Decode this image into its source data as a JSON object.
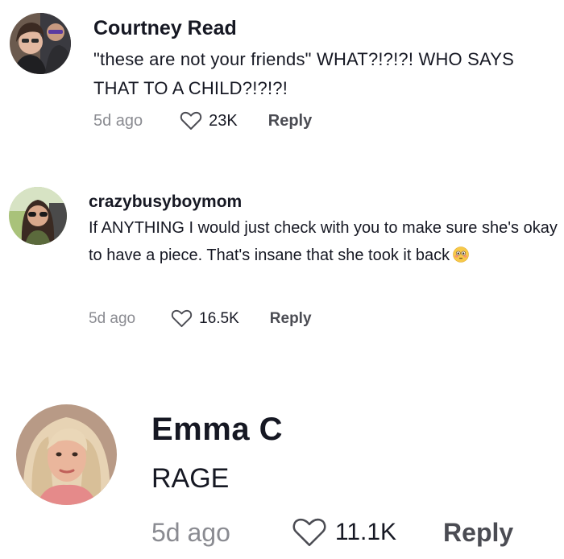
{
  "comments": [
    {
      "username": "Courtney Read",
      "text": "\"these are not your friends\" WHAT?!?!?! WHO SAYS THAT TO A CHILD?!?!?!",
      "time": "5d ago",
      "likes": "23K",
      "reply_label": "Reply",
      "avatar_icon": "user-avatar"
    },
    {
      "username": "crazybusyboymom",
      "text": "If ANYTHING I would just check with you to make sure she's okay to have a piece. That's insane that she took it back",
      "emoji": "flushed-face-emoji",
      "time": "5d ago",
      "likes": "16.5K",
      "reply_label": "Reply",
      "avatar_icon": "user-avatar"
    },
    {
      "username": "Emma  C",
      "text": "RAGE",
      "time": "5d ago",
      "likes": "11.1K",
      "reply_label": "Reply",
      "avatar_icon": "user-avatar"
    }
  ],
  "colors": {
    "text": "#161823",
    "muted": "#8a8b91",
    "reply": "#4b4c53",
    "background": "#ffffff"
  }
}
